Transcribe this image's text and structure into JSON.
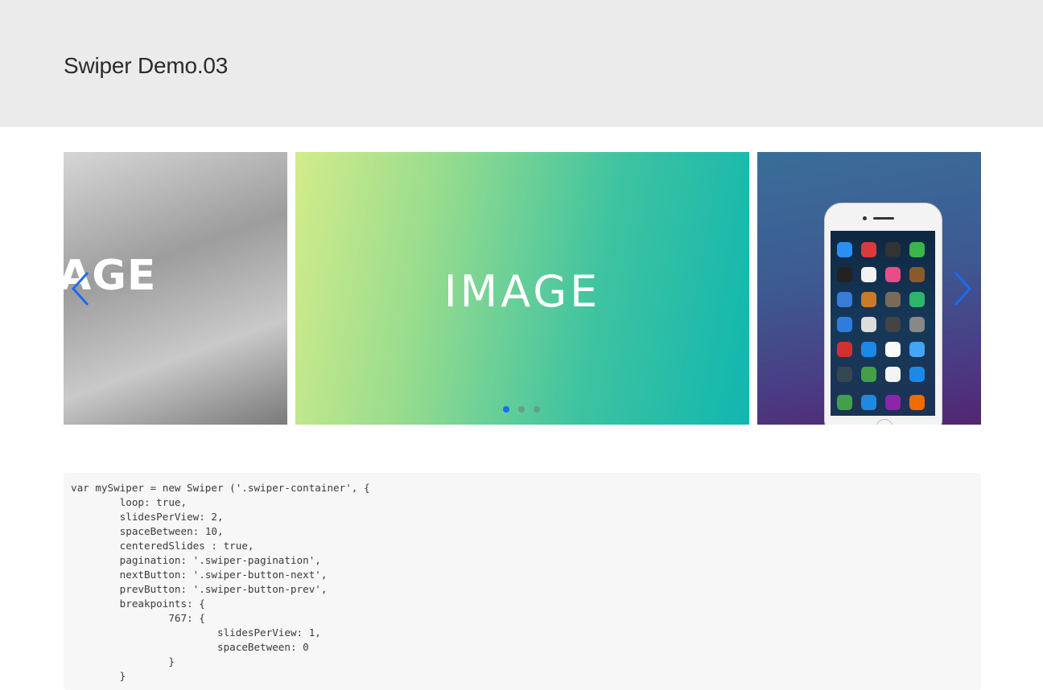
{
  "header": {
    "title": "Swiper Demo.03"
  },
  "slider": {
    "active_slide_label": "IMAGE",
    "prev_slide_partial_label": "AGE",
    "pagination_count": 3,
    "active_index": 0,
    "accent_color": "#1a6cf0"
  },
  "icons": {
    "prev": "chevron-left-icon",
    "next": "chevron-right-icon"
  },
  "code": {
    "snippet": "var mySwiper = new Swiper ('.swiper-container', {\n\tloop: true,\n\tslidesPerView: 2,\n\tspaceBetween: 10,\n\tcenteredSlides : true,\n\tpagination: '.swiper-pagination',\n\tnextButton: '.swiper-button-next',\n\tprevButton: '.swiper-button-prev',\n\tbreakpoints: {\n\t\t767: {\n\t\t\tslidesPerView: 1,\n\t\t\tspaceBetween: 0\n\t\t}\n\t}"
  }
}
